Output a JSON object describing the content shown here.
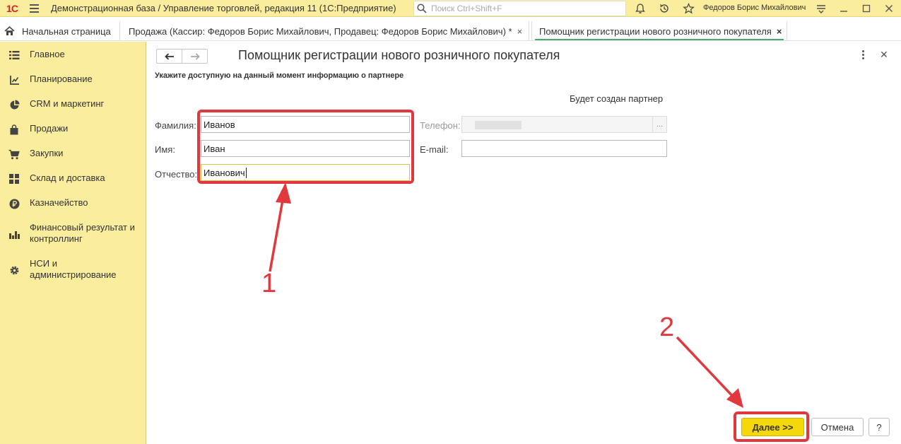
{
  "titlebar": {
    "logo": "1С",
    "title": "Демонстрационная база / Управление торговлей, редакция 11  (1С:Предприятие)",
    "search_placeholder": "Поиск Ctrl+Shift+F",
    "user": "Федоров Борис Михайлович"
  },
  "tabs": [
    {
      "label": "Начальная страница",
      "icon": "home-icon"
    },
    {
      "label": "Продажа (Кассир: Федоров Борис Михайлович, Продавец: Федоров Борис Михайлович) *",
      "close": "×"
    },
    {
      "label": "Помощник регистрации нового розничного покупателя",
      "close": "×"
    }
  ],
  "sidebar": {
    "items": [
      {
        "label": "Главное",
        "icon": "menu-list-icon"
      },
      {
        "label": "Планирование",
        "icon": "planning-icon"
      },
      {
        "label": "CRM и маркетинг",
        "icon": "pie-chart-icon"
      },
      {
        "label": "Продажи",
        "icon": "shopping-bag-icon"
      },
      {
        "label": "Закупки",
        "icon": "cart-icon"
      },
      {
        "label": "Склад и доставка",
        "icon": "warehouse-grid-icon"
      },
      {
        "label": "Казначейство",
        "icon": "ruble-coin-icon"
      },
      {
        "label": "Финансовый результат и контроллинг",
        "icon": "bar-chart-icon"
      },
      {
        "label": "НСИ и администрирование",
        "icon": "gear-icon"
      }
    ]
  },
  "form": {
    "title": "Помощник регистрации нового розничного покупателя",
    "hint": "Укажите доступную на данный момент информацию о партнере",
    "partner_note": "Будет создан партнер",
    "last_name": {
      "label": "Фамилия:",
      "value": "Иванов"
    },
    "first_name": {
      "label": "Имя:",
      "value": "Иван"
    },
    "middle_name": {
      "label": "Отчество:",
      "value": "Иванович"
    },
    "phone": {
      "label": "Телефон:",
      "value": "",
      "button": "..."
    },
    "email": {
      "label": "E-mail:",
      "value": ""
    },
    "next_button": "Далее >>",
    "cancel_button": "Отмена",
    "help_button": "?"
  },
  "annotations": {
    "step1": "1",
    "step2": "2",
    "color": "#e0383c"
  },
  "colors": {
    "panel_bg": "#fbed9e",
    "primary_button": "#f5d80a",
    "active_tab_underline": "#4aa870"
  }
}
